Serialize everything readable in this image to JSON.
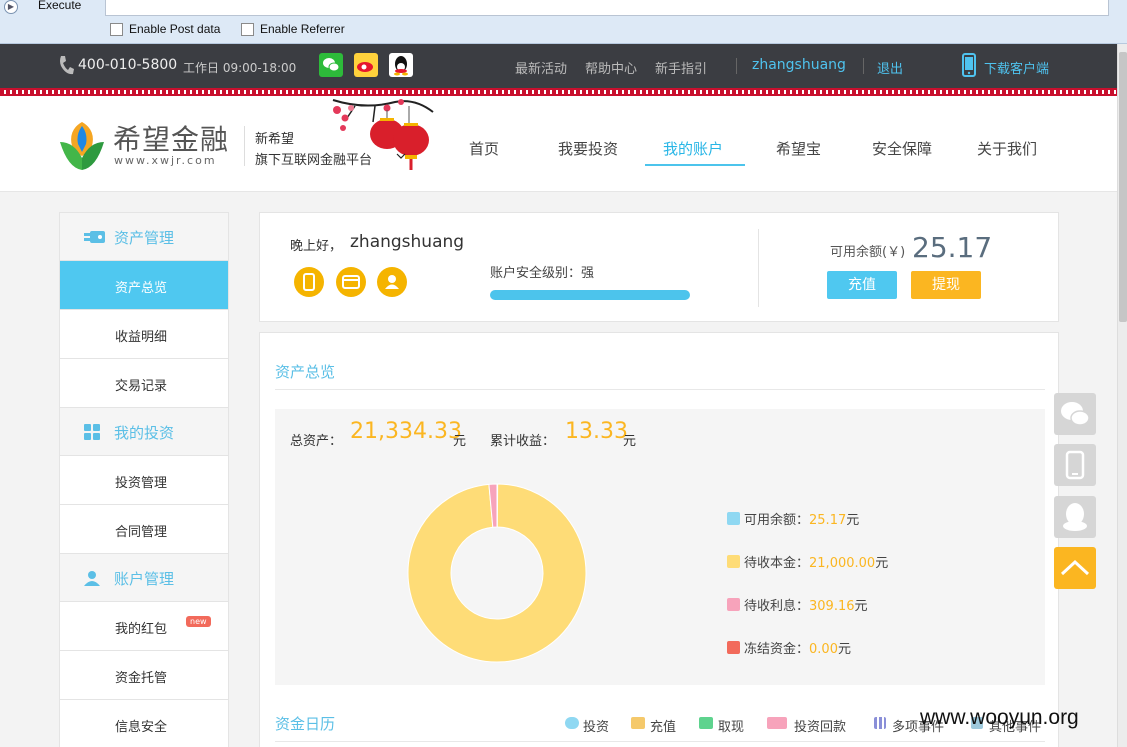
{
  "browser": {
    "execute_label": "Execute",
    "post_data_label": "Enable Post data",
    "referrer_label": "Enable Referrer"
  },
  "topbar": {
    "phone": "400-010-5800",
    "hours": "工作日 09:00-18:00",
    "links": [
      "最新活动",
      "帮助中心",
      "新手指引"
    ],
    "username": "zhangshuang",
    "logout": "退出",
    "download": "下载客户端"
  },
  "header": {
    "brand": "希望金融",
    "brand_url": "www.xwjr.com",
    "slogan_line1": "新希望",
    "slogan_line2": "旗下互联网金融平台",
    "nav": [
      "首页",
      "我要投资",
      "我的账户",
      "希望宝",
      "安全保障",
      "关于我们"
    ],
    "active_nav": "我的账户"
  },
  "sidebar": {
    "groups": [
      {
        "label": "资产管理",
        "items": [
          "资产总览",
          "收益明细",
          "交易记录"
        ]
      },
      {
        "label": "我的投资",
        "items": [
          "投资管理",
          "合同管理"
        ]
      },
      {
        "label": "账户管理",
        "items": [
          "我的红包",
          "资金托管",
          "信息安全"
        ]
      }
    ],
    "active_item": "资产总览",
    "new_badge": "new"
  },
  "account": {
    "greeting": "晚上好，",
    "username": "zhangshuang",
    "security_label": "账户安全级别：强",
    "security_level": 1.0,
    "balance_label": "可用余额(￥)",
    "balance": "25.17",
    "recharge_button": "充值",
    "withdraw_button": "提现"
  },
  "overview": {
    "title": "资产总览",
    "total_label": "总资产：",
    "total_value": "21,334.33",
    "total_unit": "元",
    "earnings_label": "累计收益：",
    "earnings_value": "13.33",
    "earnings_unit": "元",
    "legend": [
      {
        "label": "可用余额：",
        "value": "25.17",
        "unit": "元",
        "color": "#8fd8f2"
      },
      {
        "label": "待收本金：",
        "value": "21,000.00",
        "unit": "元",
        "color": "#fedc77"
      },
      {
        "label": "待收利息：",
        "value": "309.16",
        "unit": "元",
        "color": "#f7a3bb"
      },
      {
        "label": "冻结资金：",
        "value": "0.00",
        "unit": "元",
        "color": "#f26a5b"
      }
    ]
  },
  "calendar": {
    "title": "资金日历",
    "legend": [
      "投资",
      "充值",
      "取现",
      "投资回款",
      "多项事件",
      "其他事件"
    ]
  },
  "chart_data": {
    "type": "pie",
    "categories": [
      "可用余额",
      "待收本金",
      "待收利息",
      "冻结资金"
    ],
    "values": [
      25.17,
      21000.0,
      309.16,
      0.0
    ],
    "colors": [
      "#8fd8f2",
      "#fedc77",
      "#f7a3bb",
      "#f26a5b"
    ],
    "donut": true
  },
  "watermark": "www.wooyun.org"
}
